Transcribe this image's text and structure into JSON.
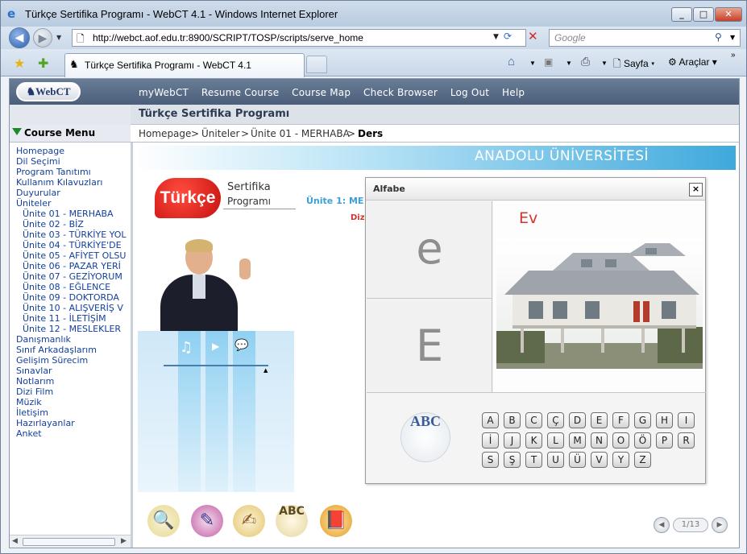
{
  "window": {
    "title": "Türkçe Sertifika Programı - WebCT 4.1 - Windows Internet Explorer",
    "min": "_",
    "max": "□",
    "close": "✕"
  },
  "address": {
    "url": "http://webct.aof.edu.tr:8900/SCRIPT/TOSP/scripts/serve_home",
    "search_placeholder": "Google"
  },
  "tabs": [
    {
      "label": "Türkçe Sertifika Programı - WebCT 4.1"
    }
  ],
  "toolbar": {
    "page": "Sayfa",
    "tools": "Araçlar"
  },
  "webct": {
    "logo": "WebCT",
    "nav": [
      "myWebCT",
      "Resume Course",
      "Course Map",
      "Check Browser",
      "Log Out",
      "Help"
    ],
    "course_title": "Türkçe Sertifika Programı",
    "menu_title": "Course Menu",
    "breadcrumb": {
      "items": [
        "Homepage",
        "Üniteler",
        "Ünite 01 - MERHABA"
      ],
      "current": "Ders",
      "sep": ">"
    },
    "menu": [
      "Homepage",
      "Dil Seçimi",
      "Program Tanıtımı",
      "Kullanım Kılavuzları",
      "Duyurular",
      "Üniteler",
      "Ünite 01 - MERHABA",
      "Ünite 02 - BİZ",
      "Ünite 03 - TÜRKİYE YOL",
      "Ünite 04 - TÜRKİYE'DE",
      "Ünite 05 - AFİYET OLSU",
      "Ünite 06 - PAZAR YERİ",
      "Ünite 07 - GEZİYORUM",
      "Ünite 08 - EĞLENCE",
      "Ünite 09 - DOKTORDA",
      "Ünite 10 - ALIŞVERİŞ V",
      "Ünite 11 - İLETİŞİM",
      "Ünite 12 - MESLEKLER",
      "Danışmanlık",
      "Sınıf Arkadaşlarım",
      "Gelişim Sürecim",
      "Sınavlar",
      "Notlarım",
      "Dizi Film",
      "Müzik",
      "İletişim",
      "Hazırlayanlar",
      "Anket"
    ]
  },
  "lesson": {
    "university": "ANADOLU ÜNİVERSİTESİ",
    "logo_word": "Türkçe",
    "logo_line1": "Sertifika",
    "logo_line2": "Programı",
    "unit_title": "Ünite 1: ME",
    "dizi": "Dizi",
    "page": "1/13"
  },
  "alfabe": {
    "title": "Alfabe",
    "close": "×",
    "lower": "e",
    "upper": "E",
    "word": "Ev",
    "abc": "ABC",
    "keys": [
      [
        "A",
        "B",
        "C",
        "Ç",
        "D",
        "E",
        "F",
        "G",
        "H",
        "I"
      ],
      [
        "İ",
        "J",
        "K",
        "L",
        "M",
        "N",
        "O",
        "Ö",
        "P",
        "R"
      ],
      [
        "S",
        "Ş",
        "T",
        "U",
        "Ü",
        "V",
        "Y",
        "Z"
      ]
    ]
  },
  "colors": {
    "accent_red": "#d6332c",
    "webct_bar": "#4b5e7a",
    "link_blue": "#123f9c"
  },
  "icons": {
    "ie_logo": "ie-logo-icon",
    "favorites": "star-icon",
    "home": "home-icon",
    "print": "printer-icon"
  }
}
